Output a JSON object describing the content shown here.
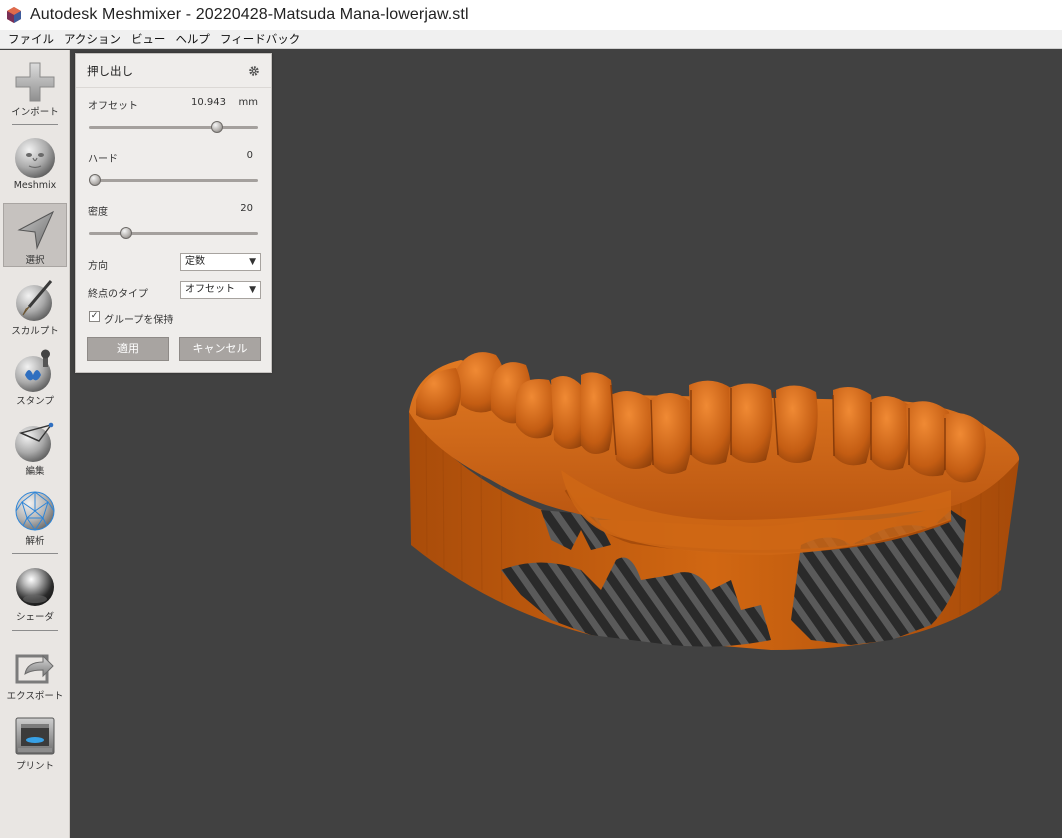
{
  "window": {
    "title": "Autodesk Meshmixer - 20220428-Matsuda Mana-lowerjaw.stl"
  },
  "menu": [
    "ファイル",
    "アクション",
    "ビュー",
    "ヘルプ",
    "フィードバック"
  ],
  "toolbar": {
    "items": [
      {
        "label": "インポート",
        "icon": "plus-icon"
      },
      {
        "label": "Meshmix",
        "icon": "face-sphere-icon"
      },
      {
        "label": "選択",
        "icon": "arrow-cursor-icon",
        "active": true
      },
      {
        "label": "スカルプト",
        "icon": "brush-sphere-icon"
      },
      {
        "label": "スタンプ",
        "icon": "stamp-sphere-icon"
      },
      {
        "label": "編集",
        "icon": "edit-sphere-icon"
      },
      {
        "label": "解析",
        "icon": "mesh-sphere-icon"
      },
      {
        "label": "シェーダ",
        "icon": "shader-sphere-icon"
      },
      {
        "label": "エクスポート",
        "icon": "export-icon"
      },
      {
        "label": "プリント",
        "icon": "printer-icon"
      }
    ]
  },
  "panel": {
    "title": "押し出し",
    "offset": {
      "label": "オフセット",
      "value": "10.943",
      "unit": "mm",
      "fraction": 0.78
    },
    "hard": {
      "label": "ハード",
      "value": "0",
      "fraction": 0.0
    },
    "density": {
      "label": "密度",
      "value": "20",
      "fraction": 0.2
    },
    "direction": {
      "label": "方向",
      "value": "定数"
    },
    "endtype": {
      "label": "終点のタイプ",
      "value": "オフセット"
    },
    "keep_groups": {
      "label": "グループを保持",
      "checked": true
    },
    "apply_label": "適用",
    "cancel_label": "キャンセル"
  },
  "colors": {
    "viewport": "#414141",
    "model": "#c65d10",
    "toolbar": "#e9e6e3",
    "panel": "#efedeb",
    "button": "#a8a4a1"
  }
}
